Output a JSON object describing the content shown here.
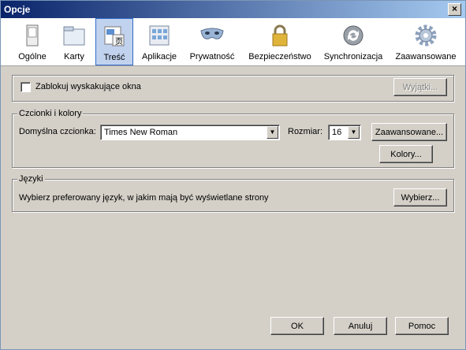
{
  "window": {
    "title": "Opcje",
    "close": "×"
  },
  "toolbar": {
    "items": [
      {
        "label": "Ogólne",
        "icon": "window-icon"
      },
      {
        "label": "Karty",
        "icon": "tabs-icon"
      },
      {
        "label": "Treść",
        "icon": "content-icon",
        "selected": true
      },
      {
        "label": "Aplikacje",
        "icon": "applications-icon"
      },
      {
        "label": "Prywatność",
        "icon": "mask-icon"
      },
      {
        "label": "Bezpieczeństwo",
        "icon": "lock-icon"
      },
      {
        "label": "Synchronizacja",
        "icon": "sync-icon"
      },
      {
        "label": "Zaawansowane",
        "icon": "gear-icon"
      }
    ]
  },
  "popup": {
    "checkbox_label": "Zablokuj wyskakujące okna",
    "exceptions_button": "Wyjątki..."
  },
  "fonts": {
    "group_label": "Czcionki i kolory",
    "default_font_label": "Domyślna czcionka:",
    "default_font_value": "Times New Roman",
    "size_label": "Rozmiar:",
    "size_value": "16",
    "advanced_button": "Zaawansowane...",
    "colors_button": "Kolory..."
  },
  "languages": {
    "group_label": "Języki",
    "description": "Wybierz preferowany język, w jakim mają być wyświetlane strony",
    "choose_button": "Wybierz..."
  },
  "footer": {
    "ok": "OK",
    "cancel": "Anuluj",
    "help": "Pomoc"
  }
}
